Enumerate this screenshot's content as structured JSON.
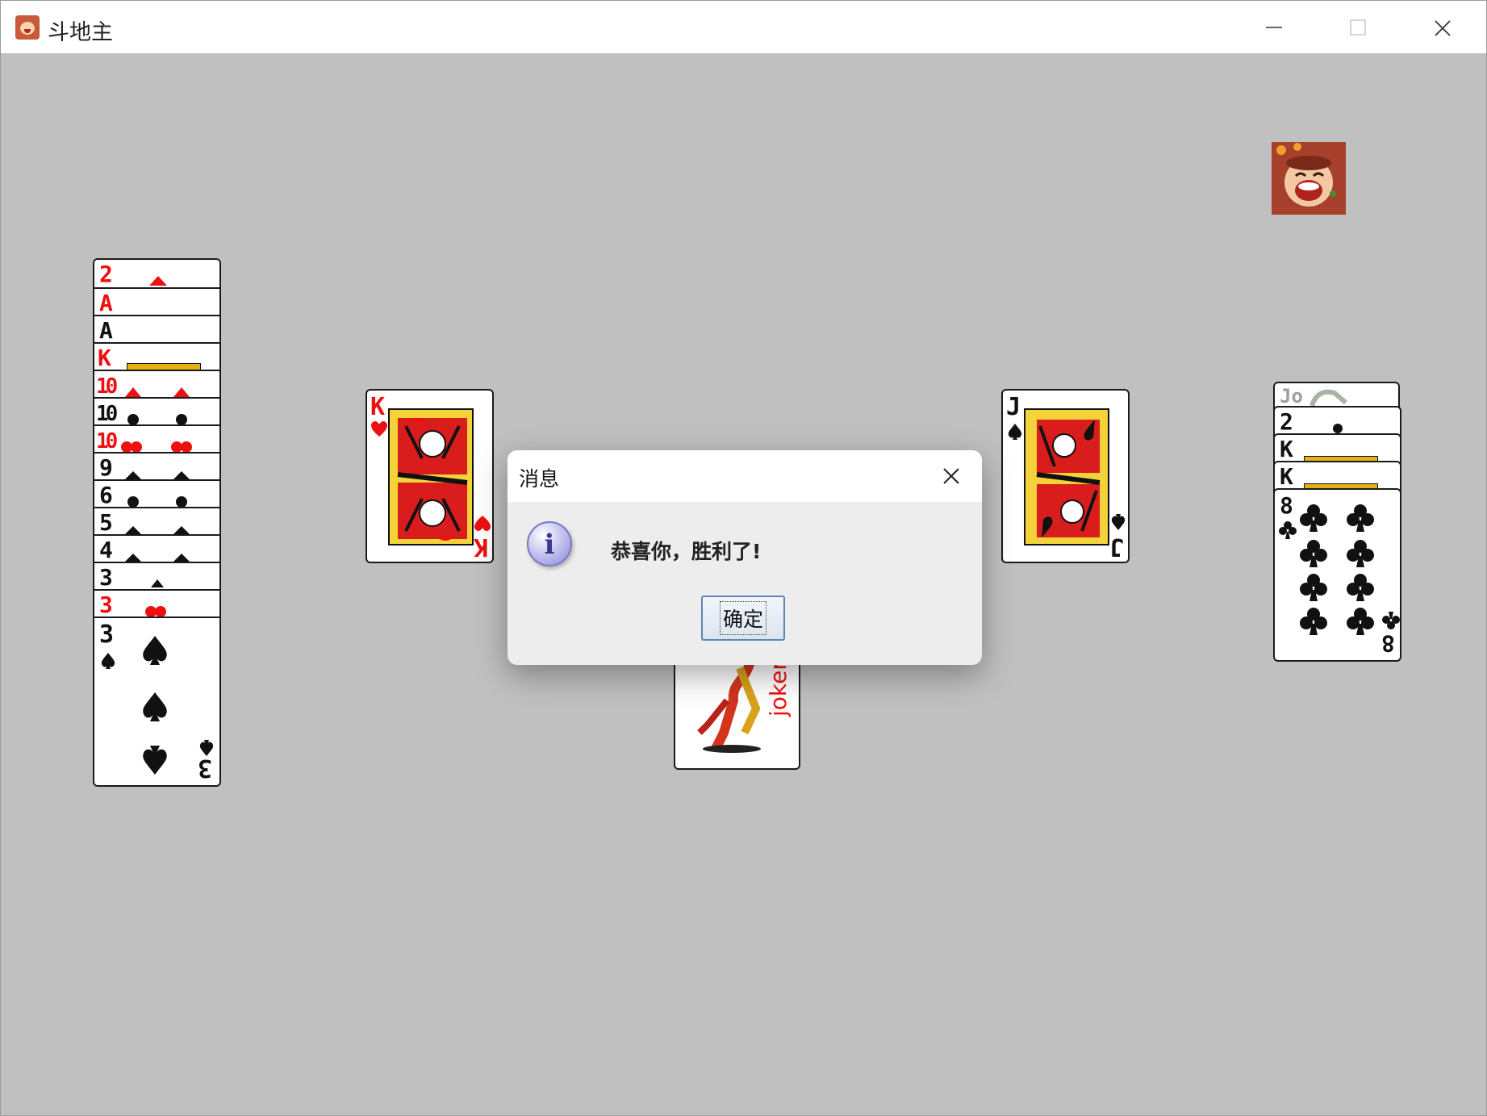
{
  "window": {
    "title": "斗地主"
  },
  "dialog": {
    "title": "消息",
    "message": "恭喜你，胜利了!",
    "ok_label": "确定"
  },
  "left_hand": [
    {
      "rank": "2",
      "color": "red"
    },
    {
      "rank": "A",
      "color": "red"
    },
    {
      "rank": "A",
      "color": "black"
    },
    {
      "rank": "K",
      "color": "red"
    },
    {
      "rank": "10",
      "color": "red"
    },
    {
      "rank": "10",
      "color": "black"
    },
    {
      "rank": "10",
      "color": "red"
    },
    {
      "rank": "9",
      "color": "black"
    },
    {
      "rank": "6",
      "color": "black"
    },
    {
      "rank": "5",
      "color": "black"
    },
    {
      "rank": "4",
      "color": "black"
    },
    {
      "rank": "3",
      "color": "black"
    },
    {
      "rank": "3",
      "color": "red"
    },
    {
      "rank": "3",
      "color": "black",
      "suit": "spades"
    }
  ],
  "played": {
    "left": {
      "rank": "K",
      "suit": "hearts",
      "color": "red"
    },
    "right": {
      "rank": "J",
      "suit": "spades",
      "color": "black"
    },
    "bottom": {
      "label": "joker",
      "color": "red"
    }
  },
  "right_hand": [
    {
      "rank": "Jo",
      "color": "gray"
    },
    {
      "rank": "2",
      "color": "black"
    },
    {
      "rank": "K",
      "color": "black"
    },
    {
      "rank": "K",
      "color": "black"
    },
    {
      "rank": "8",
      "color": "black",
      "suit": "clubs"
    }
  ]
}
